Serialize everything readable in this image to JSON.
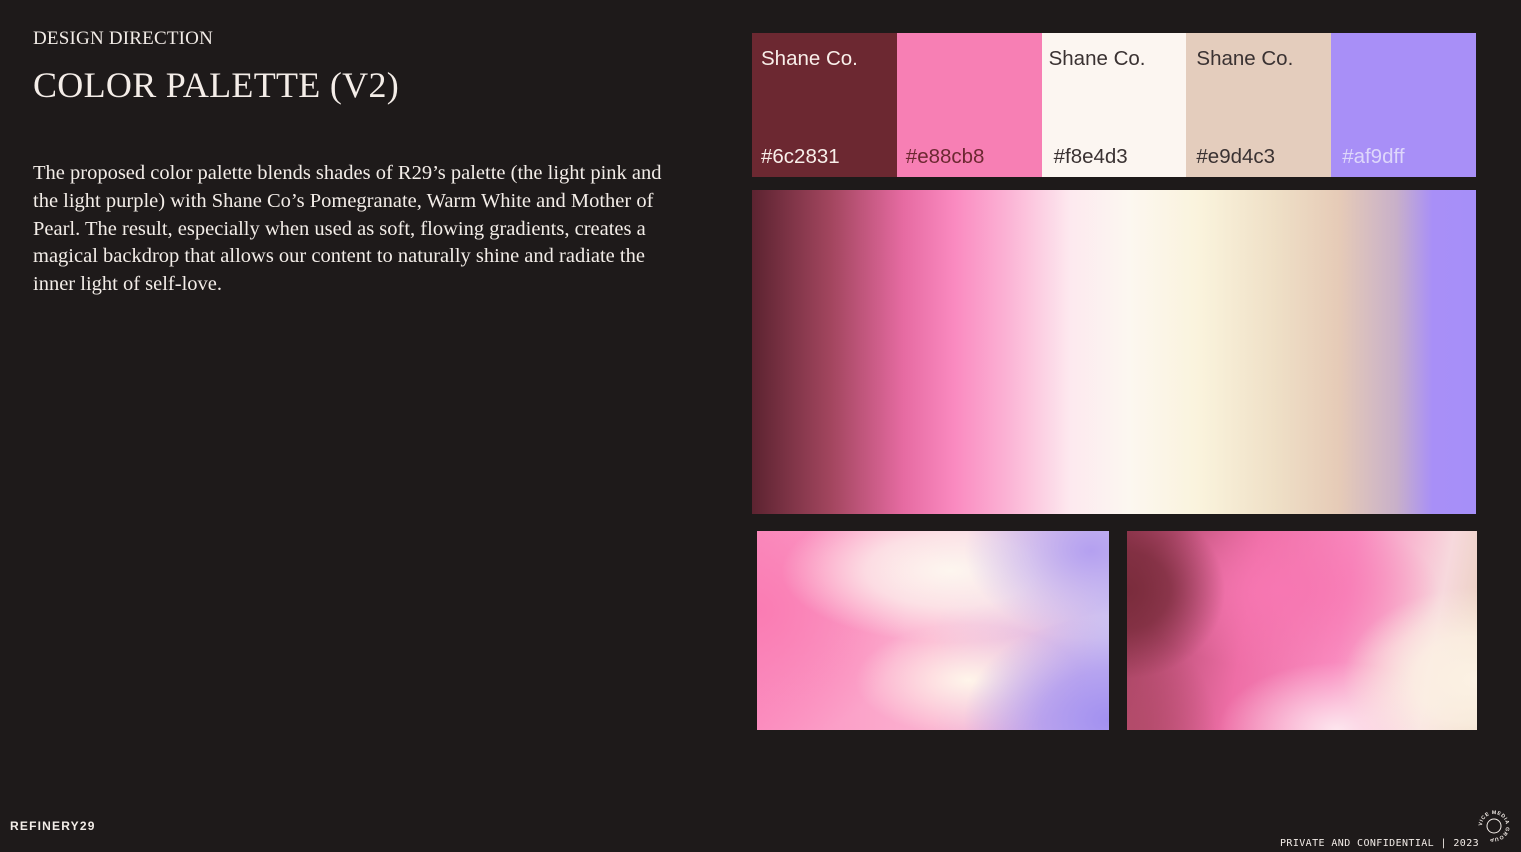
{
  "header": {
    "eyebrow": "DESIGN DIRECTION",
    "title": "COLOR PALETTE (V2)"
  },
  "body_text": "The proposed color palette blends shades of R29’s palette (the light pink and the light purple) with Shane Co’s Pomegranate, Warm White and Mother of Pearl. The result, especially when used as soft, flowing gradients, creates a magical backdrop that allows our content to naturally shine and radiate the inner light of self-love.",
  "swatches": [
    {
      "name": "Shane Co.",
      "hex": "#6c2831"
    },
    {
      "name": "",
      "hex": "#e88cb8"
    },
    {
      "name": "Shane Co.",
      "hex": "#f8e4d3"
    },
    {
      "name": "Shane Co.",
      "hex": "#e9d4c3"
    },
    {
      "name": "",
      "hex": "#af9dff"
    }
  ],
  "footer": {
    "brand": "REFINERY29",
    "confidential": "PRIVATE AND CONFIDENTIAL | 2023",
    "group_logo_text": "VICE MEDIA GROUP"
  },
  "colors": {
    "background": "#1e1a1a",
    "text": "#f3ede8"
  }
}
